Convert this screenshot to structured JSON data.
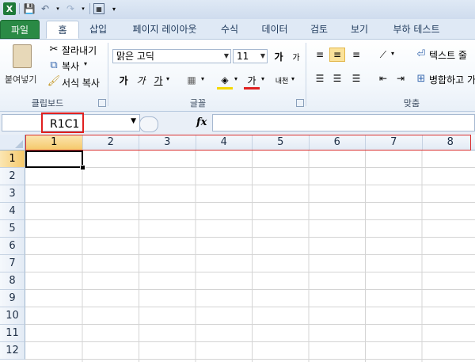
{
  "qat": {
    "icons": [
      "excel-logo",
      "save-icon",
      "undo-icon",
      "redo-icon",
      "view-icon"
    ]
  },
  "tabs": [
    "파일",
    "홈",
    "삽입",
    "페이지 레이아웃",
    "수식",
    "데이터",
    "검토",
    "보기",
    "부하 테스트"
  ],
  "clipboard": {
    "paste_label": "붙여넣기",
    "cut_label": "잘라내기",
    "copy_label": "복사",
    "format_painter_label": "서식 복사",
    "group_label": "클립보드"
  },
  "font": {
    "font_name": "맑은 고딕",
    "font_size": "11",
    "grow_label": "가",
    "shrink_label": "가",
    "bold_label": "가",
    "italic_label": "가",
    "underline_label": "가",
    "font_color_label": "가",
    "phonetic_label": "내천",
    "group_label": "글꼴"
  },
  "alignment": {
    "wrap_label": "텍스트 줄",
    "merge_label": "병합하고 가",
    "group_label": "맞춤"
  },
  "formula_bar": {
    "name_box": "R1C1",
    "fx": "fx",
    "formula": ""
  },
  "grid": {
    "columns": [
      "1",
      "2",
      "3",
      "4",
      "5",
      "6",
      "7",
      "8"
    ],
    "rows": [
      "1",
      "2",
      "3",
      "4",
      "5",
      "6",
      "7",
      "8",
      "9",
      "10",
      "11",
      "12"
    ]
  },
  "colors": {
    "file_tab": "#2a8a45",
    "highlight": "#e02020",
    "selected_header": "#f5c96b"
  }
}
